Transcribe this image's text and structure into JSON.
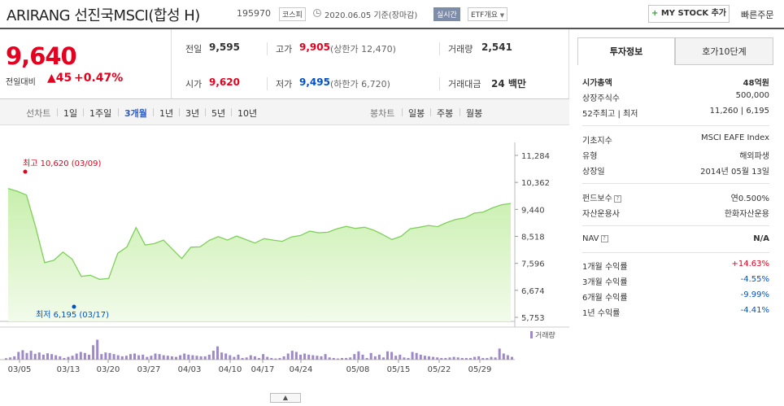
{
  "header": {
    "title": "ARIRANG 선진국MSCI(합성 H)",
    "code": "195970",
    "market_badge": "코스피",
    "date_text": "2020.06.05 기준(장마감)",
    "realtime_badge": "실시간",
    "etf_badge": "ETF개요",
    "mystock_button": "MY STOCK 추가",
    "quick_order": "빠른주문"
  },
  "quote": {
    "price": "9,640",
    "change_label": "전일대비",
    "change_value": "▲45",
    "change_pct": "+0.47%",
    "prev_close_label": "전일",
    "prev_close": "9,595",
    "high_label": "고가",
    "high": "9,905",
    "upper_limit": "(상한가 12,470)",
    "volume_label": "거래량",
    "volume": "2,541",
    "open_label": "시가",
    "open": "9,620",
    "low_label": "저가",
    "low": "9,495",
    "lower_limit": "(하한가 6,720)",
    "amount_label": "거래대금",
    "amount": "24 백만"
  },
  "periods": {
    "line_label": "선차트",
    "line_items": [
      "1일",
      "1주일",
      "3개월",
      "1년",
      "3년",
      "5년",
      "10년"
    ],
    "selected": "3개월",
    "candle_label": "봉차트",
    "candle_items": [
      "일봉",
      "주봉",
      "월봉"
    ]
  },
  "chart_data": {
    "type": "area",
    "ylim": [
      5753,
      11284
    ],
    "yticks": [
      "11,284",
      "10,362",
      "9,440",
      "8,518",
      "7,596",
      "6,674",
      "5,753"
    ],
    "xticks": [
      "03/05",
      "03/13",
      "03/20",
      "03/27",
      "04/03",
      "04/10",
      "04/17",
      "04/24",
      "05/08",
      "05/15",
      "05/22",
      "05/29"
    ],
    "max_label": "최고 10,620 (03/09)",
    "min_label": "최저 6,195 (03/17)",
    "volume_legend": "거래량",
    "series": [
      {
        "values": [
          10150,
          10060,
          9930,
          8850,
          7620,
          7700,
          7980,
          7740,
          7150,
          7190,
          7050,
          7080,
          7940,
          8160,
          8820,
          8220,
          8270,
          8390,
          8070,
          7760,
          8150,
          8160,
          8380,
          8510,
          8390,
          8530,
          8410,
          8290,
          8440,
          8390,
          8350,
          8500,
          8550,
          8700,
          8640,
          8660,
          8780,
          8860,
          8790,
          8830,
          8730,
          8580,
          8410,
          8520,
          8780,
          8830,
          8890,
          8850,
          8990,
          9100,
          9150,
          9310,
          9350,
          9490,
          9600,
          9640
        ]
      }
    ],
    "volume": [
      0.05,
      0.08,
      0.12,
      0.28,
      0.34,
      0.24,
      0.32,
      0.21,
      0.26,
      0.18,
      0.23,
      0.2,
      0.16,
      0.12,
      0.06,
      0.1,
      0.14,
      0.22,
      0.28,
      0.24,
      0.18,
      0.52,
      0.72,
      0.2,
      0.26,
      0.24,
      0.2,
      0.16,
      0.12,
      0.14,
      0.2,
      0.22,
      0.16,
      0.18,
      0.1,
      0.14,
      0.22,
      0.2,
      0.16,
      0.14,
      0.12,
      0.1,
      0.16,
      0.22,
      0.18,
      0.16,
      0.14,
      0.12,
      0.12,
      0.18,
      0.32,
      0.48,
      0.26,
      0.22,
      0.16,
      0.1,
      0.18,
      0.06,
      0.08,
      0.16,
      0.12,
      0.06,
      0.2,
      0.1,
      0.06,
      0.04,
      0.06,
      0.12,
      0.22,
      0.32,
      0.28,
      0.18,
      0.22,
      0.18,
      0.16,
      0.14,
      0.12,
      0.2,
      0.08,
      0.06,
      0.04,
      0.06,
      0.06,
      0.08,
      0.2,
      0.3,
      0.18,
      0.06,
      0.24,
      0.12,
      0.18,
      0.08,
      0.3,
      0.28,
      0.14,
      0.18,
      0.08,
      0.06,
      0.28,
      0.24,
      0.18,
      0.14,
      0.12,
      0.1,
      0.08,
      0.06,
      0.06,
      0.08,
      0.1,
      0.08,
      0.06,
      0.06,
      0.06,
      0.1,
      0.12,
      0.06,
      0.06,
      0.1,
      0.08,
      0.4,
      0.22,
      0.16,
      0.1
    ]
  },
  "right_panel": {
    "tab_info": "투자정보",
    "tab_orderbook": "호가10단계",
    "rows": [
      {
        "k": "시가총액",
        "v": "48억원"
      },
      {
        "k": "상장주식수",
        "v": "500,000"
      },
      {
        "k": "52주최고 | 최저",
        "v": "11,260 | 6,195"
      },
      {
        "k": "기초지수",
        "v": "MSCI EAFE Index"
      },
      {
        "k": "유형",
        "v": "해외파생"
      },
      {
        "k": "상장일",
        "v": "2014년 05월 13일"
      },
      {
        "k": "펀드보수",
        "v": "연0.500%"
      },
      {
        "k": "자산운용사",
        "v": "한화자산운용"
      },
      {
        "k": "NAV",
        "v": "N/A"
      },
      {
        "k": "1개월 수익률",
        "v": "+14.63%"
      },
      {
        "k": "3개월 수익률",
        "v": "-4.55%"
      },
      {
        "k": "6개월 수익률",
        "v": "-9.99%"
      },
      {
        "k": "1년 수익률",
        "v": "-4.41%"
      }
    ]
  },
  "collapse_icon": "chevron-up-icon",
  "colors": {
    "up": "#e4001e",
    "down": "#0051c7",
    "area_fill": "#d8f5c4",
    "area_line": "#7fcf5a",
    "volume_bar": "#9e8ac8"
  }
}
